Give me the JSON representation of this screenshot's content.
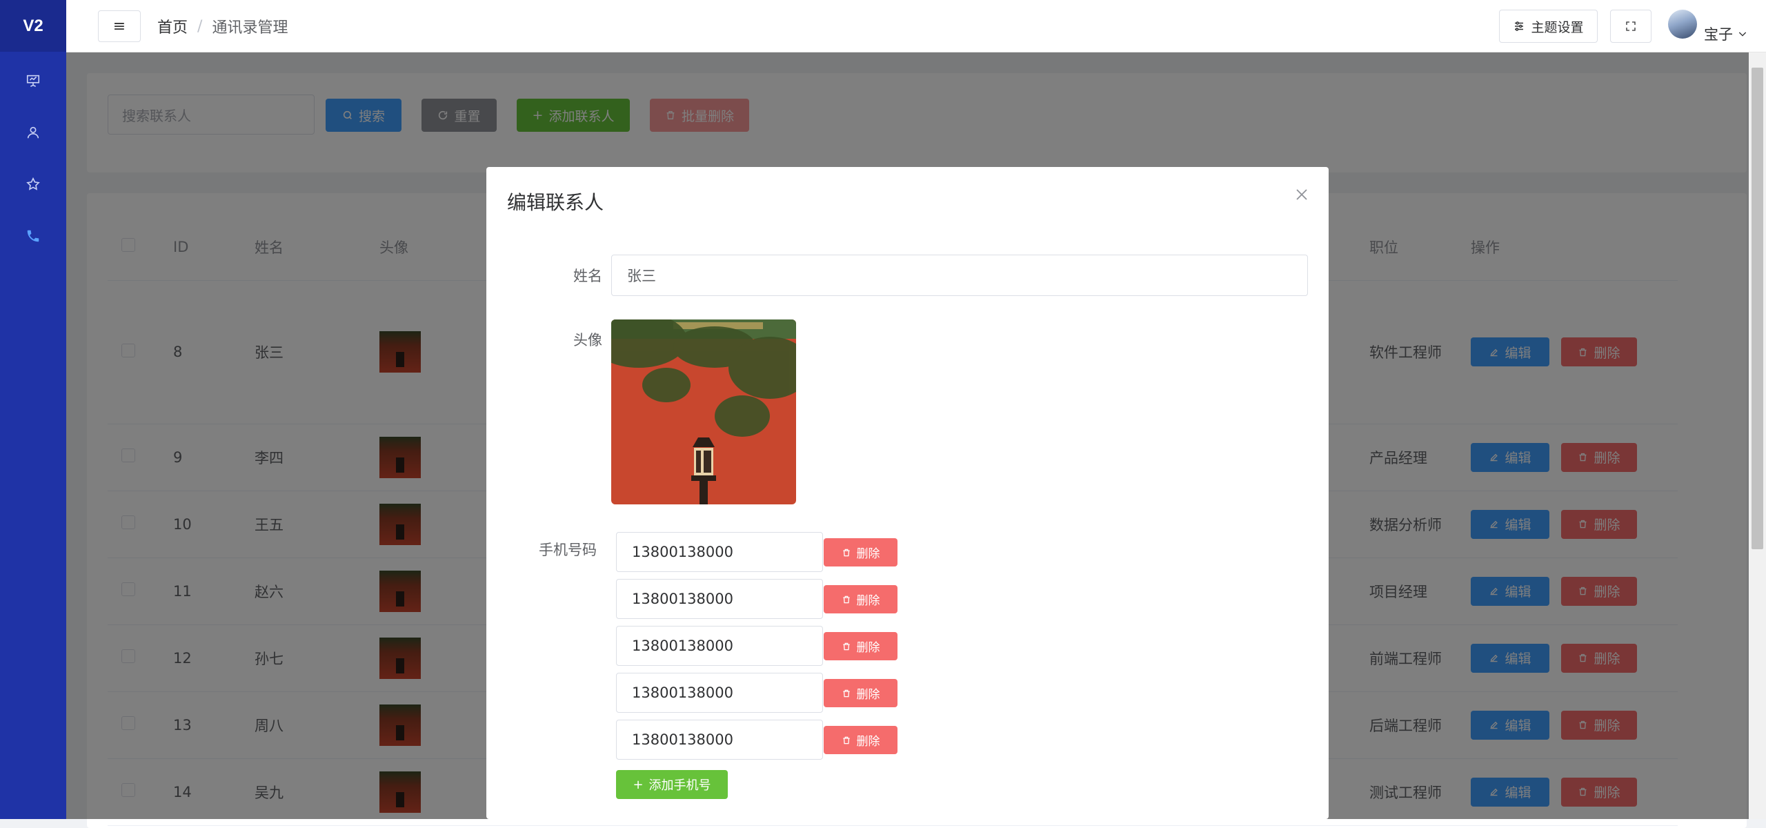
{
  "sidebar": {
    "logo": "V2",
    "items": [
      {
        "icon": "presentation-icon"
      },
      {
        "icon": "user-icon"
      },
      {
        "icon": "star-icon"
      },
      {
        "icon": "phone-icon",
        "active": true
      }
    ]
  },
  "header": {
    "breadcrumb": [
      "首页",
      "通讯录管理"
    ],
    "theme_label": "主题设置",
    "username": "宝子"
  },
  "search": {
    "placeholder": "搜索联系人",
    "search_label": "搜索",
    "reset_label": "重置",
    "add_label": "添加联系人",
    "batch_delete_label": "批量删除"
  },
  "table": {
    "columns": [
      "ID",
      "姓名",
      "头像",
      "职位",
      "操作"
    ],
    "rows": [
      {
        "id": "8",
        "name": "张三",
        "position": "软件工程师"
      },
      {
        "id": "9",
        "name": "李四",
        "position": "产品经理"
      },
      {
        "id": "10",
        "name": "王五",
        "position": "数据分析师"
      },
      {
        "id": "11",
        "name": "赵六",
        "position": "项目经理"
      },
      {
        "id": "12",
        "name": "孙七",
        "position": "前端工程师"
      },
      {
        "id": "13",
        "name": "周八",
        "position": "后端工程师"
      },
      {
        "id": "14",
        "name": "吴九",
        "position": "测试工程师"
      }
    ],
    "edit_label": "编辑",
    "delete_label": "删除"
  },
  "dialog": {
    "title": "编辑联系人",
    "name_label": "姓名",
    "name_value": "张三",
    "avatar_label": "头像",
    "phone_label": "手机号码",
    "phones": [
      "13800138000",
      "13800138000",
      "13800138000",
      "13800138000",
      "13800138000"
    ],
    "phone_delete_label": "删除",
    "add_phone_label": "添加手机号"
  },
  "colors": {
    "sidebar": "#1f33a6",
    "primary": "#409eff",
    "success": "#67c23a",
    "danger": "#f56c6c",
    "info": "#909399"
  }
}
